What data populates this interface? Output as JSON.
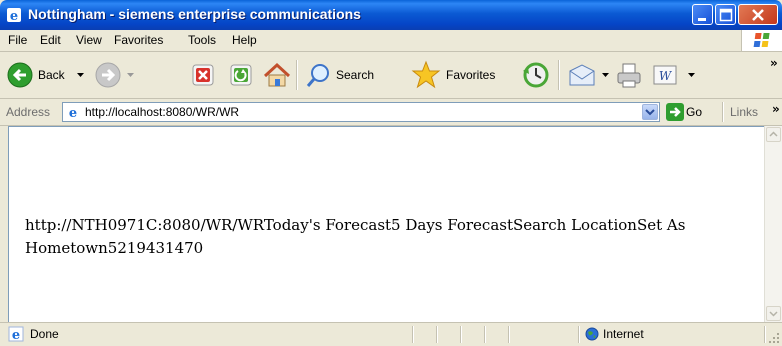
{
  "window": {
    "title": "Nottingham - siemens enterprise communications"
  },
  "menu": [
    {
      "label": "File"
    },
    {
      "label": "Edit"
    },
    {
      "label": "View"
    },
    {
      "label": "Favorites"
    },
    {
      "label": "Tools"
    },
    {
      "label": "Help"
    }
  ],
  "toolbar": {
    "back_label": "Back",
    "search_label": "Search",
    "favorites_label": "Favorites"
  },
  "address": {
    "label": "Address",
    "url": "http://localhost:8080/WR/WR",
    "go_label": "Go",
    "links_label": "Links"
  },
  "content": {
    "text": "http://NTH0971C:8080/WR/WRToday's Forecast5 Days ForecastSearch LocationSet As Hometown5219431470"
  },
  "status": {
    "text": "Done",
    "zone": "Internet"
  },
  "colors": {
    "titlebar_blue": "#0545c7",
    "chrome": "#ece9d8",
    "go_green": "#2f9e2f",
    "close_red": "#c4381c"
  }
}
